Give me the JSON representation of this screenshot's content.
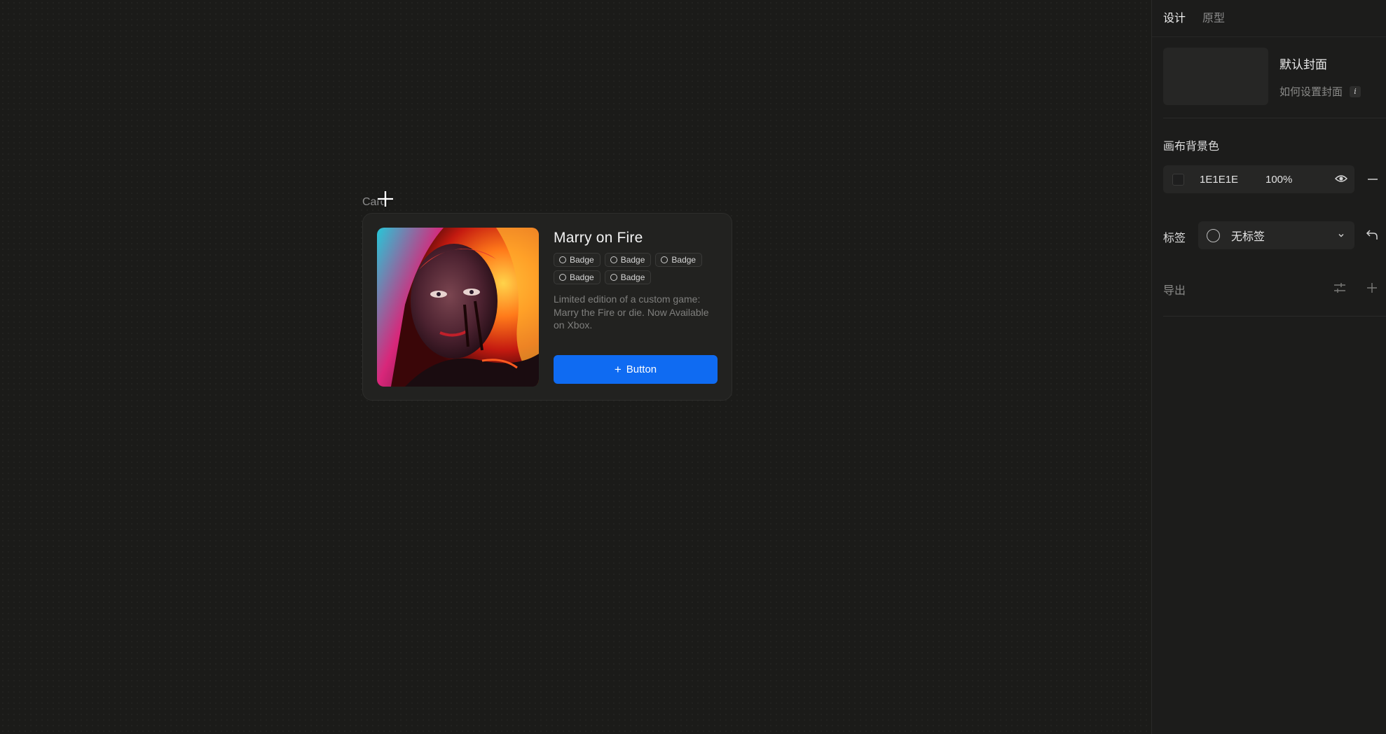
{
  "canvas": {
    "frame_label": "Card",
    "card": {
      "title": "Marry on Fire",
      "badges": [
        "Badge",
        "Badge",
        "Badge",
        "Badge",
        "Badge"
      ],
      "description": "Limited edition of a custom game: Marry the Fire or die. Now Available on Xbox.",
      "button_label": "Button",
      "button_icon": "plus-icon",
      "button_color": "#0f6bf2"
    }
  },
  "panel": {
    "tabs": [
      {
        "label": "设计",
        "active": true
      },
      {
        "label": "原型",
        "active": false
      }
    ],
    "cover": {
      "title": "默认封面",
      "help_link": "如何设置封面",
      "help_icon": "info-icon"
    },
    "canvas_bg": {
      "label": "画布背景色",
      "hex": "1E1E1E",
      "opacity": "100%",
      "swatch_color": "#1E1E1E",
      "visibility_icon": "eye-icon",
      "remove_icon": "minus-icon"
    },
    "tag": {
      "label": "标签",
      "value": "无标签",
      "dropdown_icon": "chevron-down-icon",
      "reset_icon": "undo-icon"
    },
    "export": {
      "label": "导出",
      "settings_icon": "adjust-icon",
      "add_icon": "plus-icon"
    }
  }
}
